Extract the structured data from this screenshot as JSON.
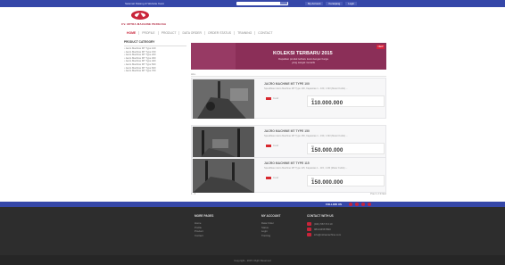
{
  "topbar": {
    "welcome": "Selamat Datang di Website Kami",
    "search_placeholder": "Search...",
    "links": [
      "My Account",
      "Keranjang",
      "Login"
    ]
  },
  "header": {
    "brand": "CV. MITRA MACHINE PERKASA",
    "nav": [
      "HOME",
      "PROFILE",
      "PRODUCT",
      "DATA ORDER",
      "ORDER STATUS",
      "TRAINING",
      "CONTACT"
    ]
  },
  "sidebar": {
    "title": "PRODUCT CATEGORY",
    "items": [
      "Jacro Machine MT Type 100",
      "Jacro Machine MT Type 150",
      "Jacro Machine MT Type 200",
      "Jacro Machine MT Type 300",
      "Jacro Machine MT Type 400",
      "Jacro Machine MT Type 500",
      "Jacro Machine MT Type 600",
      "Jacro Machine MT Type 700"
    ]
  },
  "banner": {
    "title": "KOLEKSI TERBARU 2015",
    "subtitle": "Dapatkan produk terbaru kami dengan harga yang sangat menarik",
    "tag": "NEW"
  },
  "section_label": "ALL",
  "products": [
    {
      "name": "JACRO MACHINE MT TYPE 100",
      "desc": "Spesifikasi Jacro Machine MT Type 100, Kapasitas 1 - 100, 1 M3 (Meter Kubik) ...",
      "detail": "Detail",
      "rp": "Rp",
      "price": "110.000.000"
    },
    {
      "name": "JACRO MACHINE MT TYPE 150",
      "desc": "Spesifikasi Jacro Machine MT Type 150, Kapasitas 1 - 150, 1 M3 (Meter Kubik) ...",
      "detail": "Detail",
      "rp": "Rp",
      "price": "150.000.000"
    },
    {
      "name": "JACRO MACHINE MT TYPE 115",
      "desc": "Spesifikasi Jacro Machine MT Type 115, Kapasitas 1 - 115, 1 M3 (Meter Kubik) ...",
      "detail": "Detail",
      "rp": "Rp",
      "price": "150.000.000"
    }
  ],
  "pager": {
    "left": "1 - 3",
    "right": "Prev 1 2 3 Next"
  },
  "follow": {
    "label": "FOLLOW US"
  },
  "footer": {
    "col1": {
      "title": "MORE PAGES",
      "links": [
        "Home",
        "Profile",
        "Product",
        "Contact"
      ]
    },
    "col2": {
      "title": "MY ACCOUNT",
      "links": [
        "Data Order",
        "Status",
        "Login",
        "Training"
      ]
    },
    "col3": {
      "title": "CONTACT WITH US",
      "items": [
        "(021) 567 8 9 10",
        "081234567890",
        "info@mitramachine.com"
      ]
    },
    "copyright": "Copyright - 2015. Right Reserved"
  },
  "colors": {
    "topbar": "#3547a8",
    "accent": "#c9243a",
    "banner": "#8b2f58",
    "footer": "#2d2d2d"
  }
}
